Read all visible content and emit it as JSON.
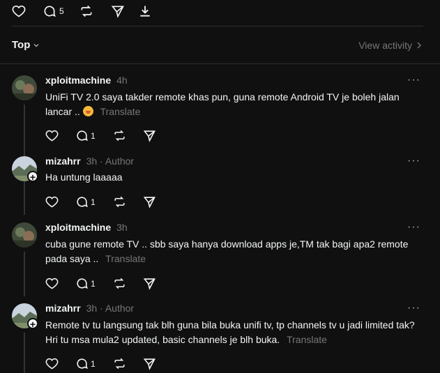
{
  "post_actions": {
    "reply_count": "5"
  },
  "sort": {
    "label": "Top"
  },
  "view_activity": {
    "label": "View activity"
  },
  "replies": [
    {
      "username": "xploitmachine",
      "time": "4h",
      "author": "",
      "text": "UniFi TV 2.0 saya takder remote khas pun, guna remote Android TV je boleh jalan lancar ..",
      "has_emoji": true,
      "translate": "Translate",
      "reply_count": "1",
      "more": "···"
    },
    {
      "username": "mizahrr",
      "time": "3h",
      "author": "· Author",
      "text": "Ha untung laaaaa",
      "has_emoji": false,
      "translate": "",
      "reply_count": "1",
      "more": "···"
    },
    {
      "username": "xploitmachine",
      "time": "3h",
      "author": "",
      "text": "cuba gune remote TV .. sbb saya hanya download apps je,TM tak bagi apa2 remote pada saya ..",
      "has_emoji": false,
      "translate": "Translate",
      "reply_count": "1",
      "more": "···"
    },
    {
      "username": "mizahrr",
      "time": "3h",
      "author": "· Author",
      "text": "Remote tv tu langsung tak blh guna bila buka unifi tv, tp channels tv u jadi limited tak? Hri tu msa mula2 updated, basic channels je blh buka.",
      "has_emoji": false,
      "translate": "Translate",
      "reply_count": "1",
      "more": "···"
    }
  ],
  "colors": {
    "background": "#101010",
    "text": "#f3f5f7",
    "muted": "#777777",
    "divider": "#2e2e2e"
  }
}
